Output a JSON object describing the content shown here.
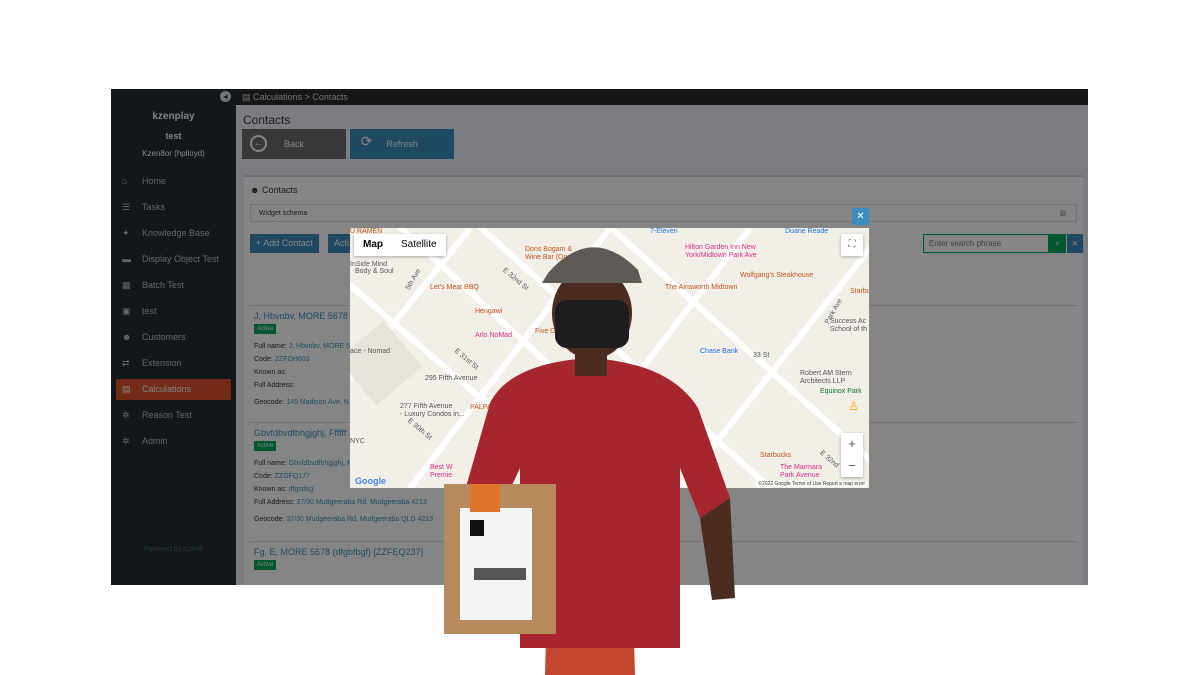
{
  "sidebar": {
    "brand": "kzenplay",
    "subtitle": "test",
    "user": "Kzen8or (hplloyd)",
    "items": [
      {
        "label": "Home",
        "icon": "home-icon"
      },
      {
        "label": "Tasks",
        "icon": "tasks-icon"
      },
      {
        "label": "Knowledge Base",
        "icon": "lightbulb-icon"
      },
      {
        "label": "Display Object Test",
        "icon": "car-icon"
      },
      {
        "label": "Batch Test",
        "icon": "grid-icon"
      },
      {
        "label": "test",
        "icon": "file-icon"
      },
      {
        "label": "Customers",
        "icon": "users-icon"
      },
      {
        "label": "Extension",
        "icon": "arrows-icon"
      },
      {
        "label": "Calculations",
        "icon": "calculator-icon",
        "active": true
      },
      {
        "label": "Reason Test",
        "icon": "gear-icon"
      },
      {
        "label": "Admin",
        "icon": "gear-icon"
      }
    ],
    "powered": "Powered by Kzen8"
  },
  "breadcrumb": {
    "root": "Calculations",
    "sep": ">",
    "current": "Contacts"
  },
  "page_title": "Contacts",
  "buttons": {
    "back": "Back",
    "refresh": "Refresh"
  },
  "contacts_box": {
    "title": "Contacts",
    "schema": "Widget schema",
    "add_contact": "+ Add Contact",
    "action": "Acti",
    "search_placeholder": "Enter search phrase"
  },
  "cards": [
    {
      "name": "J, Hbvnbv, MORE 5678 [",
      "badge": "Active",
      "full_name_label": "Full name:",
      "full_name": "J, Hbvnbv, MORE 5",
      "code_label": "Code:",
      "code": "ZZFGH603",
      "known_label": "Known as:",
      "known": "",
      "address_label": "Full Address:",
      "address": "",
      "geocode_label": "Geocode:",
      "geocode": "149 Madison Ave, N"
    },
    {
      "name": "Gbvfdbvdfbhgjghj, Ffffff",
      "badge": "Active",
      "full_name_label": "Full name:",
      "full_name": "Gbvfdbvdfbhgjghj, F",
      "code_label": "Code:",
      "code": "ZZGFQ177",
      "known_label": "Known as:",
      "known": "dfgsdsg",
      "address_label": "Full Address:",
      "address": "37/30 Mudgeeraba Rd, Mudgeeraba 4213",
      "geocode_label": "Geocode:",
      "geocode": "37/30 Mudgeeraba Rd, Mudgeeraba QLD 4213"
    },
    {
      "name": "Fg, E, MORE 5678 (dfgbfbgf) [ZZFEQ237]",
      "badge": "Active"
    }
  ],
  "map": {
    "tab_map": "Map",
    "tab_satellite": "Satellite",
    "google": "Google",
    "footer": "©2022 Google   Terms of Use   Report a map error",
    "pois": [
      {
        "t": "Dons Bogam &",
        "c": "r"
      },
      {
        "t": "Wine Bar (Original)",
        "c": "r"
      },
      {
        "t": "Let's Meat BBQ",
        "c": "r"
      },
      {
        "t": "Hengawi",
        "c": "r"
      },
      {
        "t": "Arlo NoMad",
        "c": "p"
      },
      {
        "t": "Five Guys",
        "c": "r"
      },
      {
        "t": "295 Fifth Avenue",
        "c": "k"
      },
      {
        "t": "277 Fifth Avenue",
        "c": "k"
      },
      {
        "t": "- Luxury Condos in...",
        "c": "k"
      },
      {
        "t": "InSide Mind",
        "c": "k"
      },
      {
        "t": "Body & Soul",
        "c": "k"
      },
      {
        "t": "ace - Nomad",
        "c": "k"
      },
      {
        "t": "Hilton Garden Inn New",
        "c": "p"
      },
      {
        "t": "York/Midtown Park Ave",
        "c": "p"
      },
      {
        "t": "Wolfgang's Steakhouse",
        "c": "r"
      },
      {
        "t": "The Ainsworth Midtown",
        "c": "r"
      },
      {
        "t": "Chase Bank",
        "c": "b"
      },
      {
        "t": "Robert AM Stern",
        "c": "k"
      },
      {
        "t": "Architects LLP",
        "c": "k"
      },
      {
        "t": "Equinox Park",
        "c": "g"
      },
      {
        "t": "Success Ac",
        "c": "k"
      },
      {
        "t": "School of th",
        "c": "k"
      },
      {
        "t": "Starbucks",
        "c": "r"
      },
      {
        "t": "The Marmara",
        "c": "p"
      },
      {
        "t": "Park Avenue",
        "c": "p"
      },
      {
        "t": "Best W",
        "c": "p"
      },
      {
        "t": "Premie",
        "c": "p"
      },
      {
        "t": "7-Eleven",
        "c": "b"
      },
      {
        "t": "Duane Reade",
        "c": "b"
      },
      {
        "t": "Starbu",
        "c": "r"
      },
      {
        "t": "PALPA",
        "c": "r"
      },
      {
        "t": "NYC",
        "c": "k"
      },
      {
        "t": "U RAMEN",
        "c": "r"
      }
    ],
    "streets": [
      "5th Ave",
      "E 32nd St",
      "E 31st St",
      "E 30th St",
      "Park Ave",
      "33 St",
      "E 32nd"
    ]
  }
}
